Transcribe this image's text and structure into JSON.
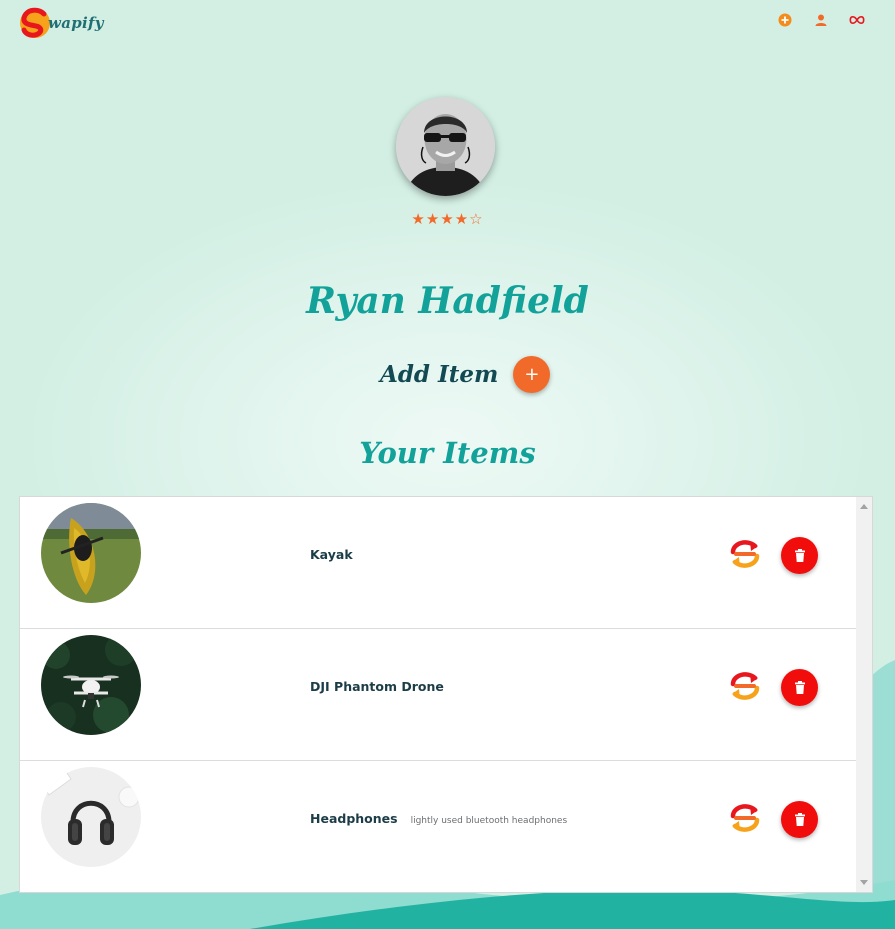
{
  "app": {
    "logo_text": "wapify"
  },
  "nav": {
    "icons": [
      "add-circle-icon",
      "person-icon",
      "infinity-icon"
    ]
  },
  "profile": {
    "name": "Ryan Hadfield",
    "rating": 4,
    "rating_max": 5,
    "stars_text": "★★★★☆"
  },
  "actions": {
    "add_item_label": "Add Item",
    "add_button_glyph": "+"
  },
  "section": {
    "items_title": "Your Items"
  },
  "items": [
    {
      "name": "Kayak",
      "description": ""
    },
    {
      "name": "DJI Phantom Drone",
      "description": ""
    },
    {
      "name": "Headphones",
      "description": "lightly used bluetooth headphones"
    }
  ],
  "colors": {
    "accent_orange": "#f26a2a",
    "brand_teal": "#12a29a",
    "dark_teal": "#124953",
    "delete_red": "#f20d0d",
    "background_mint": "#d3efe4"
  }
}
